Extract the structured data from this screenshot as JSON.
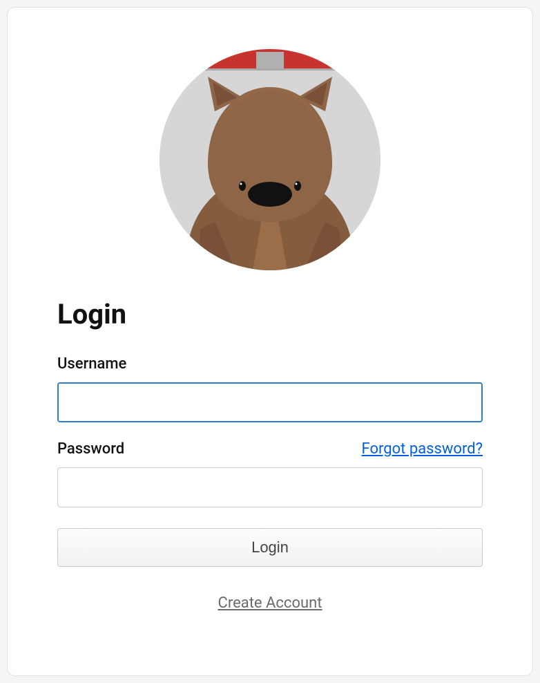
{
  "login": {
    "title": "Login",
    "username_label": "Username",
    "username_value": "",
    "password_label": "Password",
    "password_value": "",
    "forgot_password_label": "Forgot password?",
    "login_button_label": "Login",
    "create_account_label": "Create Account"
  }
}
